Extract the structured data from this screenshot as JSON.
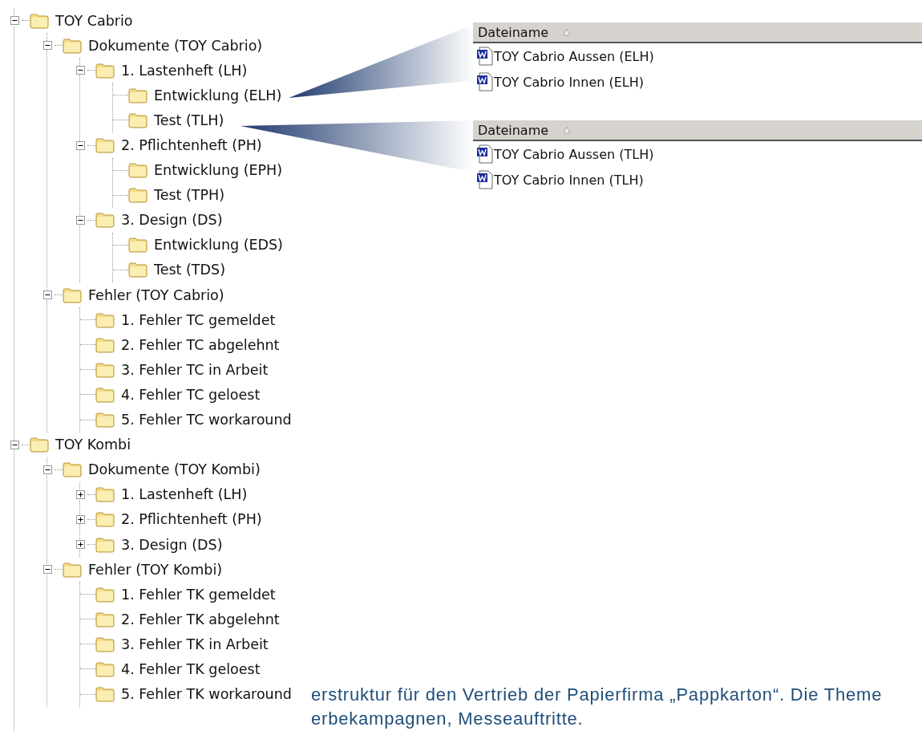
{
  "tree": [
    {
      "kind": "branch",
      "label": "TOY Cabrio",
      "expanded": true,
      "children": [
        {
          "kind": "branch",
          "label": "Dokumente (TOY Cabrio)",
          "expanded": true,
          "children": [
            {
              "kind": "branch",
              "label": "1. Lastenheft (LH)",
              "expanded": true,
              "children": [
                {
                  "kind": "leaf",
                  "label": "Entwicklung (ELH)"
                },
                {
                  "kind": "leaf",
                  "label": "Test (TLH)"
                }
              ]
            },
            {
              "kind": "branch",
              "label": "2. Pflichtenheft (PH)",
              "expanded": true,
              "children": [
                {
                  "kind": "leaf",
                  "label": "Entwicklung (EPH)"
                },
                {
                  "kind": "leaf",
                  "label": "Test (TPH)"
                }
              ]
            },
            {
              "kind": "branch",
              "label": "3. Design (DS)",
              "expanded": true,
              "children": [
                {
                  "kind": "leaf",
                  "label": "Entwicklung (EDS)"
                },
                {
                  "kind": "leaf",
                  "label": "Test (TDS)"
                }
              ]
            }
          ]
        },
        {
          "kind": "branch",
          "label": "Fehler (TOY Cabrio)",
          "expanded": true,
          "children": [
            {
              "kind": "leaf",
              "label": "1. Fehler TC gemeldet"
            },
            {
              "kind": "leaf",
              "label": "2. Fehler TC abgelehnt"
            },
            {
              "kind": "leaf",
              "label": "3. Fehler TC in Arbeit"
            },
            {
              "kind": "leaf",
              "label": "4. Fehler TC geloest"
            },
            {
              "kind": "leaf",
              "label": "5. Fehler TC workaround"
            }
          ]
        }
      ]
    },
    {
      "kind": "branch",
      "label": "TOY Kombi",
      "expanded": true,
      "children": [
        {
          "kind": "branch",
          "label": "Dokumente (TOY Kombi)",
          "expanded": true,
          "children": [
            {
              "kind": "branch",
              "label": "1. Lastenheft (LH)",
              "expanded": false
            },
            {
              "kind": "branch",
              "label": "2. Pflichtenheft (PH)",
              "expanded": false
            },
            {
              "kind": "branch",
              "label": "3. Design (DS)",
              "expanded": false
            }
          ]
        },
        {
          "kind": "branch",
          "label": "Fehler (TOY Kombi)",
          "expanded": true,
          "children": [
            {
              "kind": "leaf",
              "label": "1. Fehler TK gemeldet"
            },
            {
              "kind": "leaf",
              "label": "2. Fehler TK abgelehnt"
            },
            {
              "kind": "leaf",
              "label": "3. Fehler TK in Arbeit"
            },
            {
              "kind": "leaf",
              "label": "4. Fehler TK geloest"
            },
            {
              "kind": "leaf",
              "label": "5. Fehler TK workaround"
            }
          ]
        }
      ]
    }
  ],
  "file_lists": [
    {
      "column": "Dateiname",
      "files": [
        "TOY Cabrio Aussen (ELH)",
        "TOY Cabrio Innen (ELH)"
      ]
    },
    {
      "column": "Dateiname",
      "files": [
        "TOY Cabrio Aussen (TLH)",
        "TOY Cabrio Innen (TLH)"
      ]
    }
  ],
  "caption": [
    "erstruktur für den Vertrieb der Papierfirma „Pappkarton“. Die Theme",
    "erbekampagnen, Messeauftritte."
  ]
}
